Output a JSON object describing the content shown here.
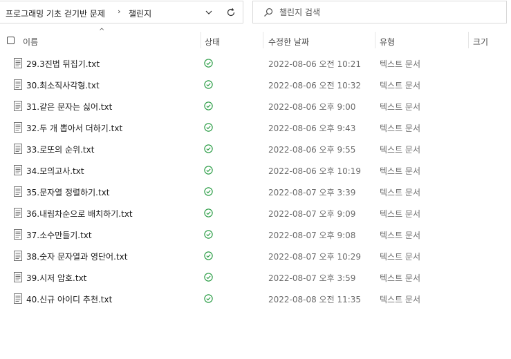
{
  "address_bar": {
    "crumbs": [
      "프로그래밍 기초 걷기반 문제",
      "챌린지"
    ],
    "separator": "›",
    "dropdown_icon": "chevron-down-icon",
    "refresh_icon": "refresh-icon"
  },
  "search": {
    "placeholder": "챌린지 검색",
    "icon": "search-icon"
  },
  "columns": {
    "name": "이름",
    "status": "상태",
    "modified": "수정한 날짜",
    "type": "유형",
    "size": "크기",
    "sort_indicator": "^"
  },
  "files": [
    {
      "name": "29.3진법 뒤집기.txt",
      "modified": "2022-08-06 오전 10:21",
      "type": "텍스트 문서",
      "size": ""
    },
    {
      "name": "30.최소직사각형.txt",
      "modified": "2022-08-06 오전 10:32",
      "type": "텍스트 문서",
      "size": ""
    },
    {
      "name": "31.같은 문자는 싫어.txt",
      "modified": "2022-08-06 오후 9:00",
      "type": "텍스트 문서",
      "size": ""
    },
    {
      "name": "32.두 개 뽑아서 더하기.txt",
      "modified": "2022-08-06 오후 9:43",
      "type": "텍스트 문서",
      "size": ""
    },
    {
      "name": "33.로또의 순위.txt",
      "modified": "2022-08-06 오후 9:55",
      "type": "텍스트 문서",
      "size": ""
    },
    {
      "name": "34.모의고사.txt",
      "modified": "2022-08-06 오후 10:19",
      "type": "텍스트 문서",
      "size": ""
    },
    {
      "name": "35.문자열 정렬하기.txt",
      "modified": "2022-08-07 오후 3:39",
      "type": "텍스트 문서",
      "size": ""
    },
    {
      "name": "36.내림차순으로 배치하기.txt",
      "modified": "2022-08-07 오후 9:09",
      "type": "텍스트 문서",
      "size": ""
    },
    {
      "name": "37.소수만들기.txt",
      "modified": "2022-08-07 오후 9:08",
      "type": "텍스트 문서",
      "size": ""
    },
    {
      "name": "38.숫자 문자열과 영단어.txt",
      "modified": "2022-08-07 오후 10:29",
      "type": "텍스트 문서",
      "size": ""
    },
    {
      "name": "39.시저 암호.txt",
      "modified": "2022-08-07 오후 3:59",
      "type": "텍스트 문서",
      "size": ""
    },
    {
      "name": "40.신규 아이디 추천.txt",
      "modified": "2022-08-08 오전 11:35",
      "type": "텍스트 문서",
      "size": ""
    }
  ],
  "colors": {
    "status_ok": "#2e9e48",
    "file_icon": "#6f6f6f",
    "border": "#d9d9d9"
  }
}
